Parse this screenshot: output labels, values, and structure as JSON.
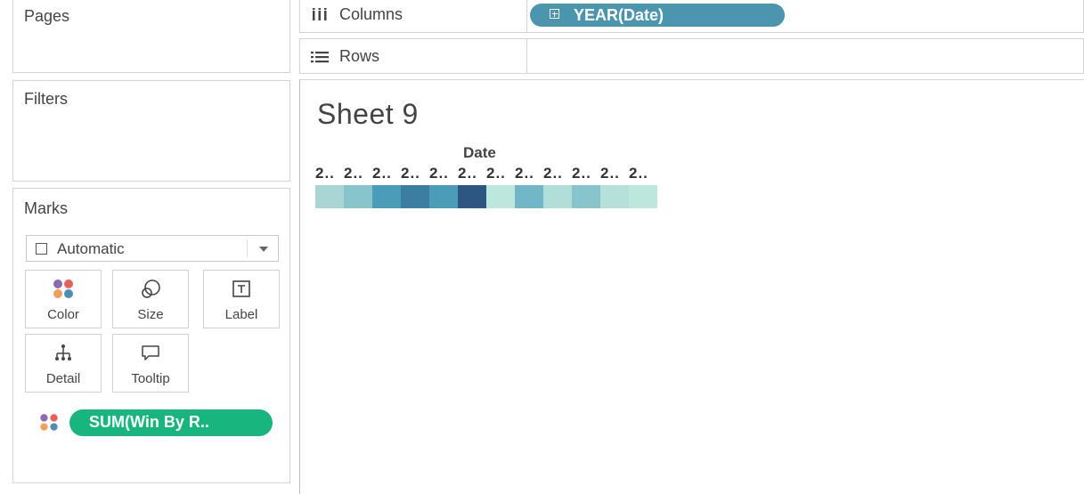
{
  "panels": {
    "pages_title": "Pages",
    "filters_title": "Filters",
    "marks_title": "Marks"
  },
  "marks": {
    "type_label": "Automatic",
    "buttons": [
      {
        "label": "Color",
        "icon": "color-dots-icon"
      },
      {
        "label": "Size",
        "icon": "size-circles-icon"
      },
      {
        "label": "Label",
        "icon": "text-label-icon"
      },
      {
        "label": "Detail",
        "icon": "detail-tree-icon"
      },
      {
        "label": "Tooltip",
        "icon": "tooltip-bubble-icon"
      }
    ],
    "field_pill": "SUM(Win By R..",
    "field_pill_color": "#18b57e"
  },
  "shelves": {
    "columns_label": "Columns",
    "columns_pill": "YEAR(Date)",
    "columns_pill_color": "#4b96ae",
    "rows_label": "Rows"
  },
  "viz": {
    "sheet_title": "Sheet 9",
    "column_header": "Date"
  },
  "chart_data": {
    "type": "heatmap",
    "xlabel": "Date",
    "x": [
      "2..",
      "2..",
      "2..",
      "2..",
      "2..",
      "2..",
      "2..",
      "2..",
      "2..",
      "2..",
      "2..",
      "2.."
    ],
    "color_field": "SUM(Win By R..",
    "cell_colors": [
      "#a7d6d5",
      "#86c6ca",
      "#4a9cb8",
      "#3c7ea2",
      "#4a9cb8",
      "#2d5782",
      "#bde6dc",
      "#72b7c8",
      "#b0ded9",
      "#86c6ca",
      "#b6e1da",
      "#bde6dc"
    ]
  }
}
